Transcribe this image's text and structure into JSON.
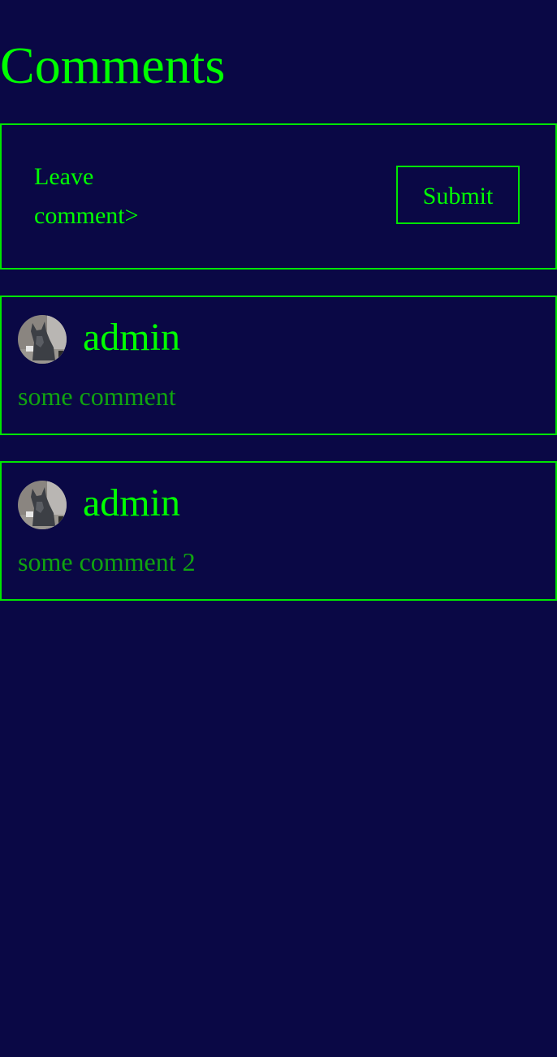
{
  "page": {
    "title": "Comments"
  },
  "composer": {
    "placeholder_label": "Leave comment>",
    "submit_label": "Submit"
  },
  "comments": [
    {
      "author": "admin",
      "avatar_icon": "dog-avatar-icon",
      "text": "some comment"
    },
    {
      "author": "admin",
      "avatar_icon": "dog-avatar-icon",
      "text": "some comment 2"
    }
  ],
  "colors": {
    "background": "#0a0845",
    "accent": "#00ff00",
    "border": "#00e600",
    "comment_text": "#10a410"
  }
}
